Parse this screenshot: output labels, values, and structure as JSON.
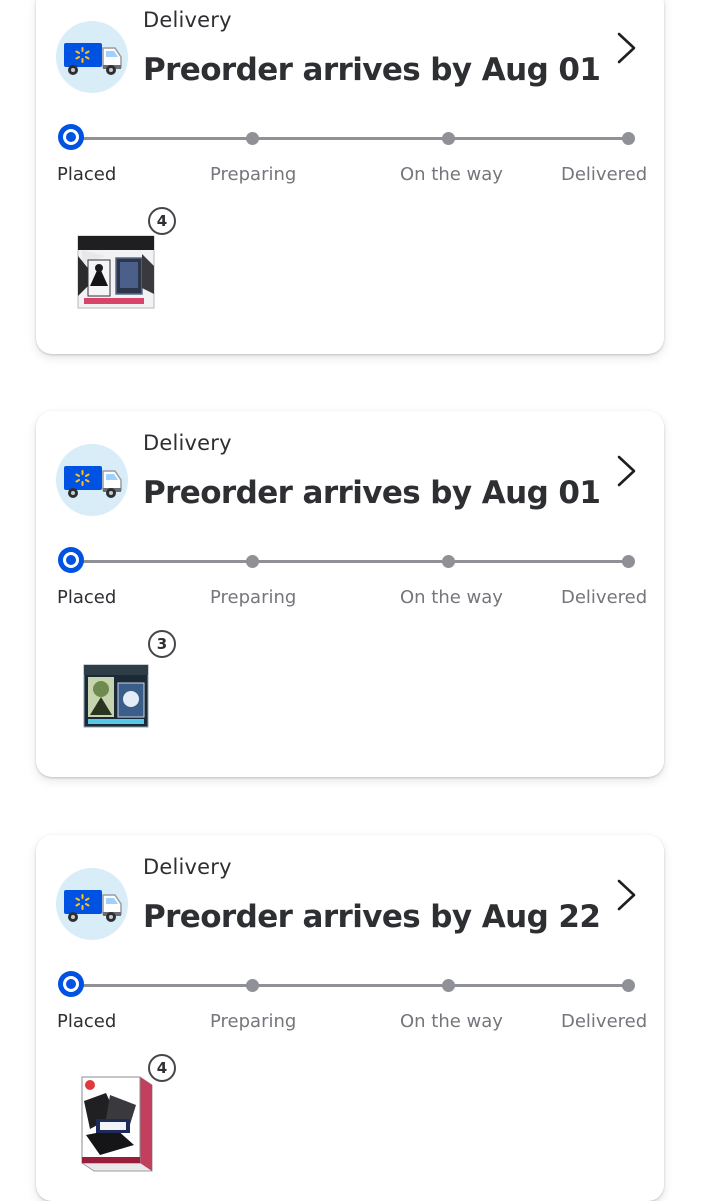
{
  "orders": [
    {
      "method": "Delivery",
      "headline": "Preorder arrives by Aug 01",
      "steps": [
        "Placed",
        "Preparing",
        "On the way",
        "Delivered"
      ],
      "current_step": 0,
      "item": {
        "quantity": "4",
        "thumbnail": "product-thumbnail"
      }
    },
    {
      "method": "Delivery",
      "headline": "Preorder arrives by Aug 01",
      "steps": [
        "Placed",
        "Preparing",
        "On the way",
        "Delivered"
      ],
      "current_step": 0,
      "item": {
        "quantity": "3",
        "thumbnail": "product-thumbnail"
      }
    },
    {
      "method": "Delivery",
      "headline": "Preorder arrives by Aug 22",
      "steps": [
        "Placed",
        "Preparing",
        "On the way",
        "Delivered"
      ],
      "current_step": 0,
      "item": {
        "quantity": "4",
        "thumbnail": "product-thumbnail"
      }
    }
  ],
  "icons": {
    "truck": "delivery-truck-icon",
    "chevron": "chevron-right-icon"
  },
  "colors": {
    "accent": "#0053e2",
    "track": "#909196",
    "icon_bg": "#d8edf8",
    "text": "#2e2f32",
    "muted_text": "#74767c"
  }
}
